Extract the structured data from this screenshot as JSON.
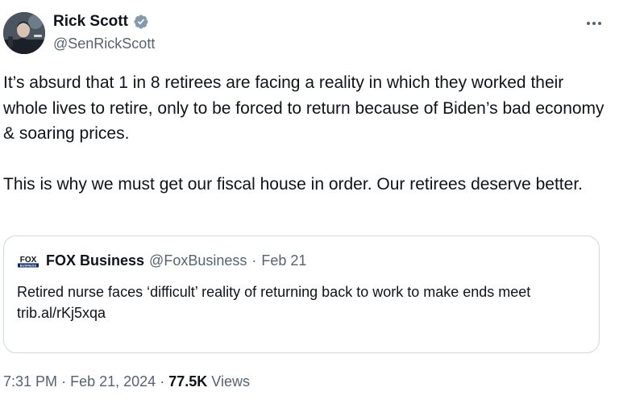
{
  "author": {
    "display_name": "Rick Scott",
    "handle": "@SenRickScott",
    "verified": true
  },
  "more_icon": "more-horizontal-icon",
  "tweet": {
    "paragraph_1": "It’s absurd that 1 in 8 retirees are facing a reality in which they worked their whole lives to retire, only to be forced to return because of Biden’s bad economy & soaring prices.",
    "paragraph_2": "This is why we must get our fiscal house in order. Our retirees deserve better."
  },
  "quote": {
    "logo_text": "FOX",
    "logo_subtext": "BUSINESS",
    "display_name": "FOX Business",
    "handle": "@FoxBusiness",
    "separator": "·",
    "date": "Feb 21",
    "text": "Retired nurse faces ‘difficult’ reality of returning back to work to make ends meet",
    "link": "trib.al/rKj5xqa"
  },
  "footer": {
    "time": "7:31 PM",
    "sep1": "·",
    "date": "Feb 21, 2024",
    "sep2": "·",
    "views_count": "77.5K",
    "views_label": "Views"
  },
  "colors": {
    "text_primary": "#0f1419",
    "text_secondary": "#536471",
    "verified_badge": "#829aab",
    "border": "#cfd9de"
  }
}
